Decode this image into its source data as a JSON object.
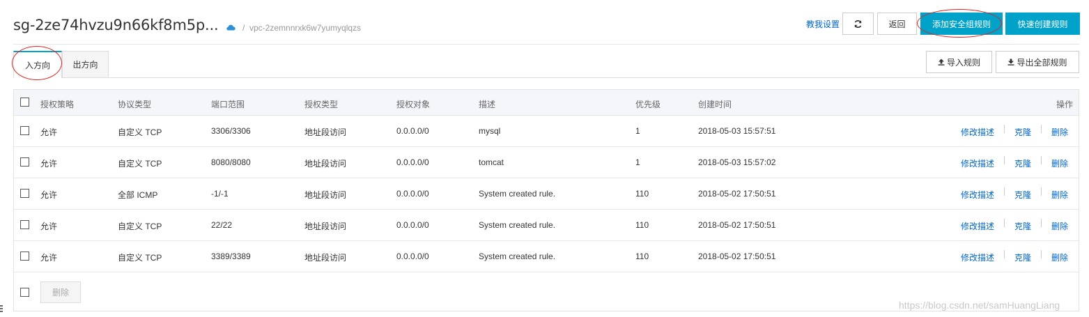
{
  "header": {
    "title": "sg-2ze74hvzu9n66kf8m5p...",
    "separator": "/",
    "vpc_id": "vpc-2zemnnrxk6w7yumyqlqzs",
    "help_link": "教我设置",
    "back_label": "返回",
    "add_rule_label": "添加安全组规则",
    "quick_create_label": "快速创建规则"
  },
  "tabs": [
    {
      "label": "入方向",
      "active": true
    },
    {
      "label": "出方向",
      "active": false
    }
  ],
  "toolbar": {
    "import_label": "导入规则",
    "export_label": "导出全部规则"
  },
  "table": {
    "columns": [
      "授权策略",
      "协议类型",
      "端口范围",
      "授权类型",
      "授权对象",
      "描述",
      "优先级",
      "创建时间",
      "操作"
    ],
    "rows": [
      {
        "policy": "允许",
        "protocol": "自定义 TCP",
        "port": "3306/3306",
        "auth_type": "地址段访问",
        "target": "0.0.0.0/0",
        "desc": "mysql",
        "priority": "1",
        "created": "2018-05-03 15:57:51"
      },
      {
        "policy": "允许",
        "protocol": "自定义 TCP",
        "port": "8080/8080",
        "auth_type": "地址段访问",
        "target": "0.0.0.0/0",
        "desc": "tomcat",
        "priority": "1",
        "created": "2018-05-03 15:57:02"
      },
      {
        "policy": "允许",
        "protocol": "全部 ICMP",
        "port": "-1/-1",
        "auth_type": "地址段访问",
        "target": "0.0.0.0/0",
        "desc": "System created rule.",
        "priority": "110",
        "created": "2018-05-02 17:50:51"
      },
      {
        "policy": "允许",
        "protocol": "自定义 TCP",
        "port": "22/22",
        "auth_type": "地址段访问",
        "target": "0.0.0.0/0",
        "desc": "System created rule.",
        "priority": "110",
        "created": "2018-05-02 17:50:51"
      },
      {
        "policy": "允许",
        "protocol": "自定义 TCP",
        "port": "3389/3389",
        "auth_type": "地址段访问",
        "target": "0.0.0.0/0",
        "desc": "System created rule.",
        "priority": "110",
        "created": "2018-05-02 17:50:51"
      }
    ],
    "actions": {
      "edit": "修改描述",
      "clone": "克隆",
      "delete": "删除"
    },
    "batch_delete_label": "删除"
  },
  "watermark": "https://blog.csdn.net/samHuangLiang",
  "colors": {
    "primary": "#00a2ca",
    "link": "#0066cc",
    "annotation": "#e02020"
  }
}
